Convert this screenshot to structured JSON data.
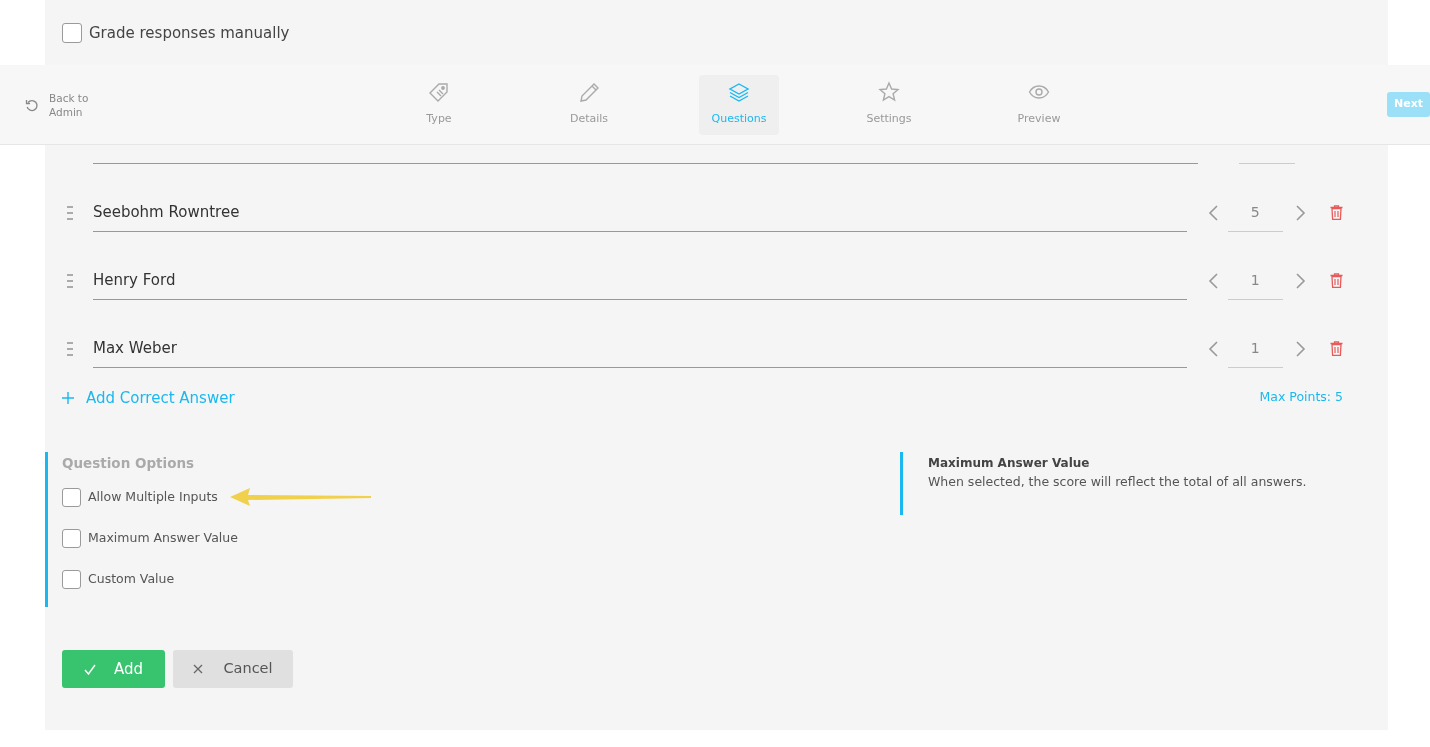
{
  "grading_type": {
    "options": [
      {
        "label": "Grade responses manually",
        "checked": false
      }
    ]
  },
  "header": {
    "back_link": "Back to Admin",
    "steps": [
      {
        "label": "Type",
        "selected": false
      },
      {
        "label": "Details",
        "selected": false
      },
      {
        "label": "Questions",
        "selected": true
      },
      {
        "label": "Settings",
        "selected": false
      },
      {
        "label": "Preview",
        "selected": false
      }
    ],
    "next_button": "Next"
  },
  "answer_creator": {
    "answers": [
      {
        "text": "Seebohm Rowntree",
        "points": "5"
      },
      {
        "text": "Henry Ford",
        "points": "1"
      },
      {
        "text": "Max Weber",
        "points": "1"
      }
    ],
    "add_link": "Add Correct Answer",
    "max_points": "Max Points: 5"
  },
  "question_options": {
    "heading": "Question Options",
    "options": [
      {
        "label": "Allow Multiple Inputs",
        "checked": false
      },
      {
        "label": "Maximum Answer Value",
        "checked": false
      },
      {
        "label": "Custom Value",
        "checked": false
      }
    ]
  },
  "info": {
    "title": "Maximum Answer Value",
    "text": "When selected, the score will reflect the total of all answers."
  },
  "buttons": {
    "add": "Add",
    "cancel": "Cancel"
  }
}
